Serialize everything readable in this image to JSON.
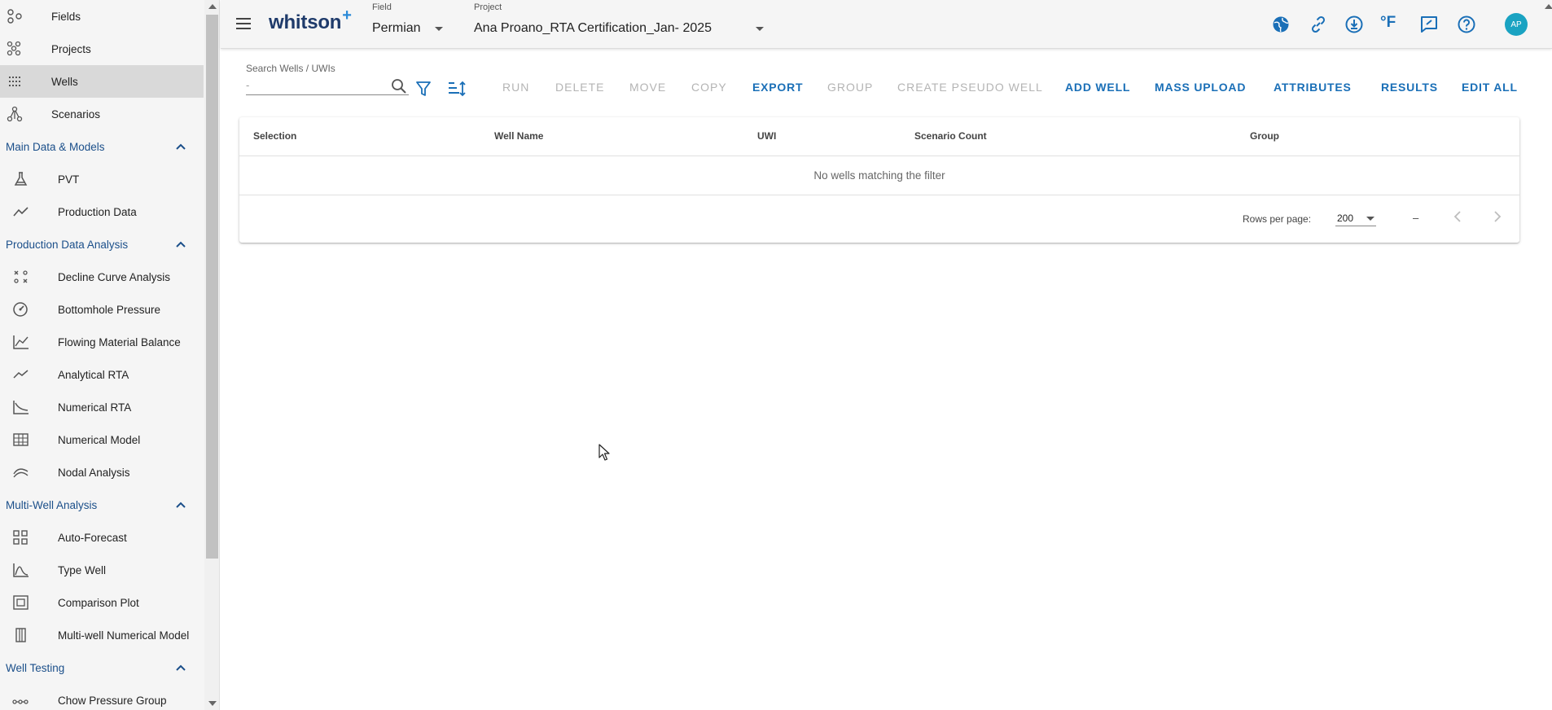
{
  "sidebar": {
    "top_items": [
      {
        "label": "Fields",
        "icon": "fields-icon"
      },
      {
        "label": "Projects",
        "icon": "projects-icon"
      },
      {
        "label": "Wells",
        "icon": "wells-icon",
        "active": true
      },
      {
        "label": "Scenarios",
        "icon": "scenarios-icon"
      }
    ],
    "sections": [
      {
        "title": "Main Data & Models",
        "items": [
          {
            "label": "PVT",
            "icon": "flask-icon"
          },
          {
            "label": "Production Data",
            "icon": "line-chart-icon"
          }
        ]
      },
      {
        "title": "Production Data Analysis",
        "items": [
          {
            "label": "Decline Curve Analysis",
            "icon": "decline-curve-icon"
          },
          {
            "label": "Bottomhole Pressure",
            "icon": "gauge-icon"
          },
          {
            "label": "Flowing Material Balance",
            "icon": "fmb-chart-icon"
          },
          {
            "label": "Analytical RTA",
            "icon": "trend-icon"
          },
          {
            "label": "Numerical RTA",
            "icon": "numerical-rta-icon"
          },
          {
            "label": "Numerical Model",
            "icon": "grid-model-icon"
          },
          {
            "label": "Nodal Analysis",
            "icon": "nodal-icon"
          }
        ]
      },
      {
        "title": "Multi-Well Analysis",
        "items": [
          {
            "label": "Auto-Forecast",
            "icon": "auto-forecast-icon"
          },
          {
            "label": "Type Well",
            "icon": "type-well-icon"
          },
          {
            "label": "Comparison Plot",
            "icon": "comparison-plot-icon"
          },
          {
            "label": "Multi-well Numerical Model",
            "icon": "multiwell-model-icon"
          }
        ]
      },
      {
        "title": "Well Testing",
        "items": [
          {
            "label": "Chow Pressure Group",
            "icon": "chow-pressure-icon"
          }
        ]
      }
    ]
  },
  "header": {
    "logo_text": "whitson",
    "logo_plus": "+",
    "field_caption": "Field",
    "field_value": "Permian",
    "project_caption": "Project",
    "project_value": "Ana Proano_RTA Certification_Jan- 2025",
    "temperature_unit": "°F",
    "avatar_initials": "AP",
    "icons": [
      "globe-icon",
      "link-icon",
      "download-icon",
      "temperature-unit-icon",
      "feedback-icon",
      "help-icon"
    ]
  },
  "toolbar": {
    "search_label": "Search Wells / UWIs",
    "search_value": "-",
    "buttons": [
      {
        "label": "RUN",
        "enabled": false
      },
      {
        "label": "DELETE",
        "enabled": false
      },
      {
        "label": "MOVE",
        "enabled": false
      },
      {
        "label": "COPY",
        "enabled": false
      },
      {
        "label": "EXPORT",
        "enabled": true
      },
      {
        "label": "GROUP",
        "enabled": false
      },
      {
        "label": "CREATE PSEUDO WELL",
        "enabled": false
      },
      {
        "label": "ADD WELL",
        "enabled": true
      },
      {
        "label": "MASS UPLOAD",
        "enabled": true
      },
      {
        "label": "ATTRIBUTES",
        "enabled": true
      },
      {
        "label": "RESULTS",
        "enabled": true
      },
      {
        "label": "EDIT ALL",
        "enabled": true
      }
    ]
  },
  "table": {
    "columns": [
      "Selection",
      "Well Name",
      "UWI",
      "Scenario Count",
      "Group"
    ],
    "empty_message": "No wells matching the filter",
    "rows_per_page_label": "Rows per page:",
    "rows_per_page_value": "200",
    "page_range": "–"
  },
  "colors": {
    "accent": "#1a6fb7",
    "section_title": "#1b4f8a",
    "avatar": "#1aa3c2",
    "disabled": "#b4b4b4"
  }
}
